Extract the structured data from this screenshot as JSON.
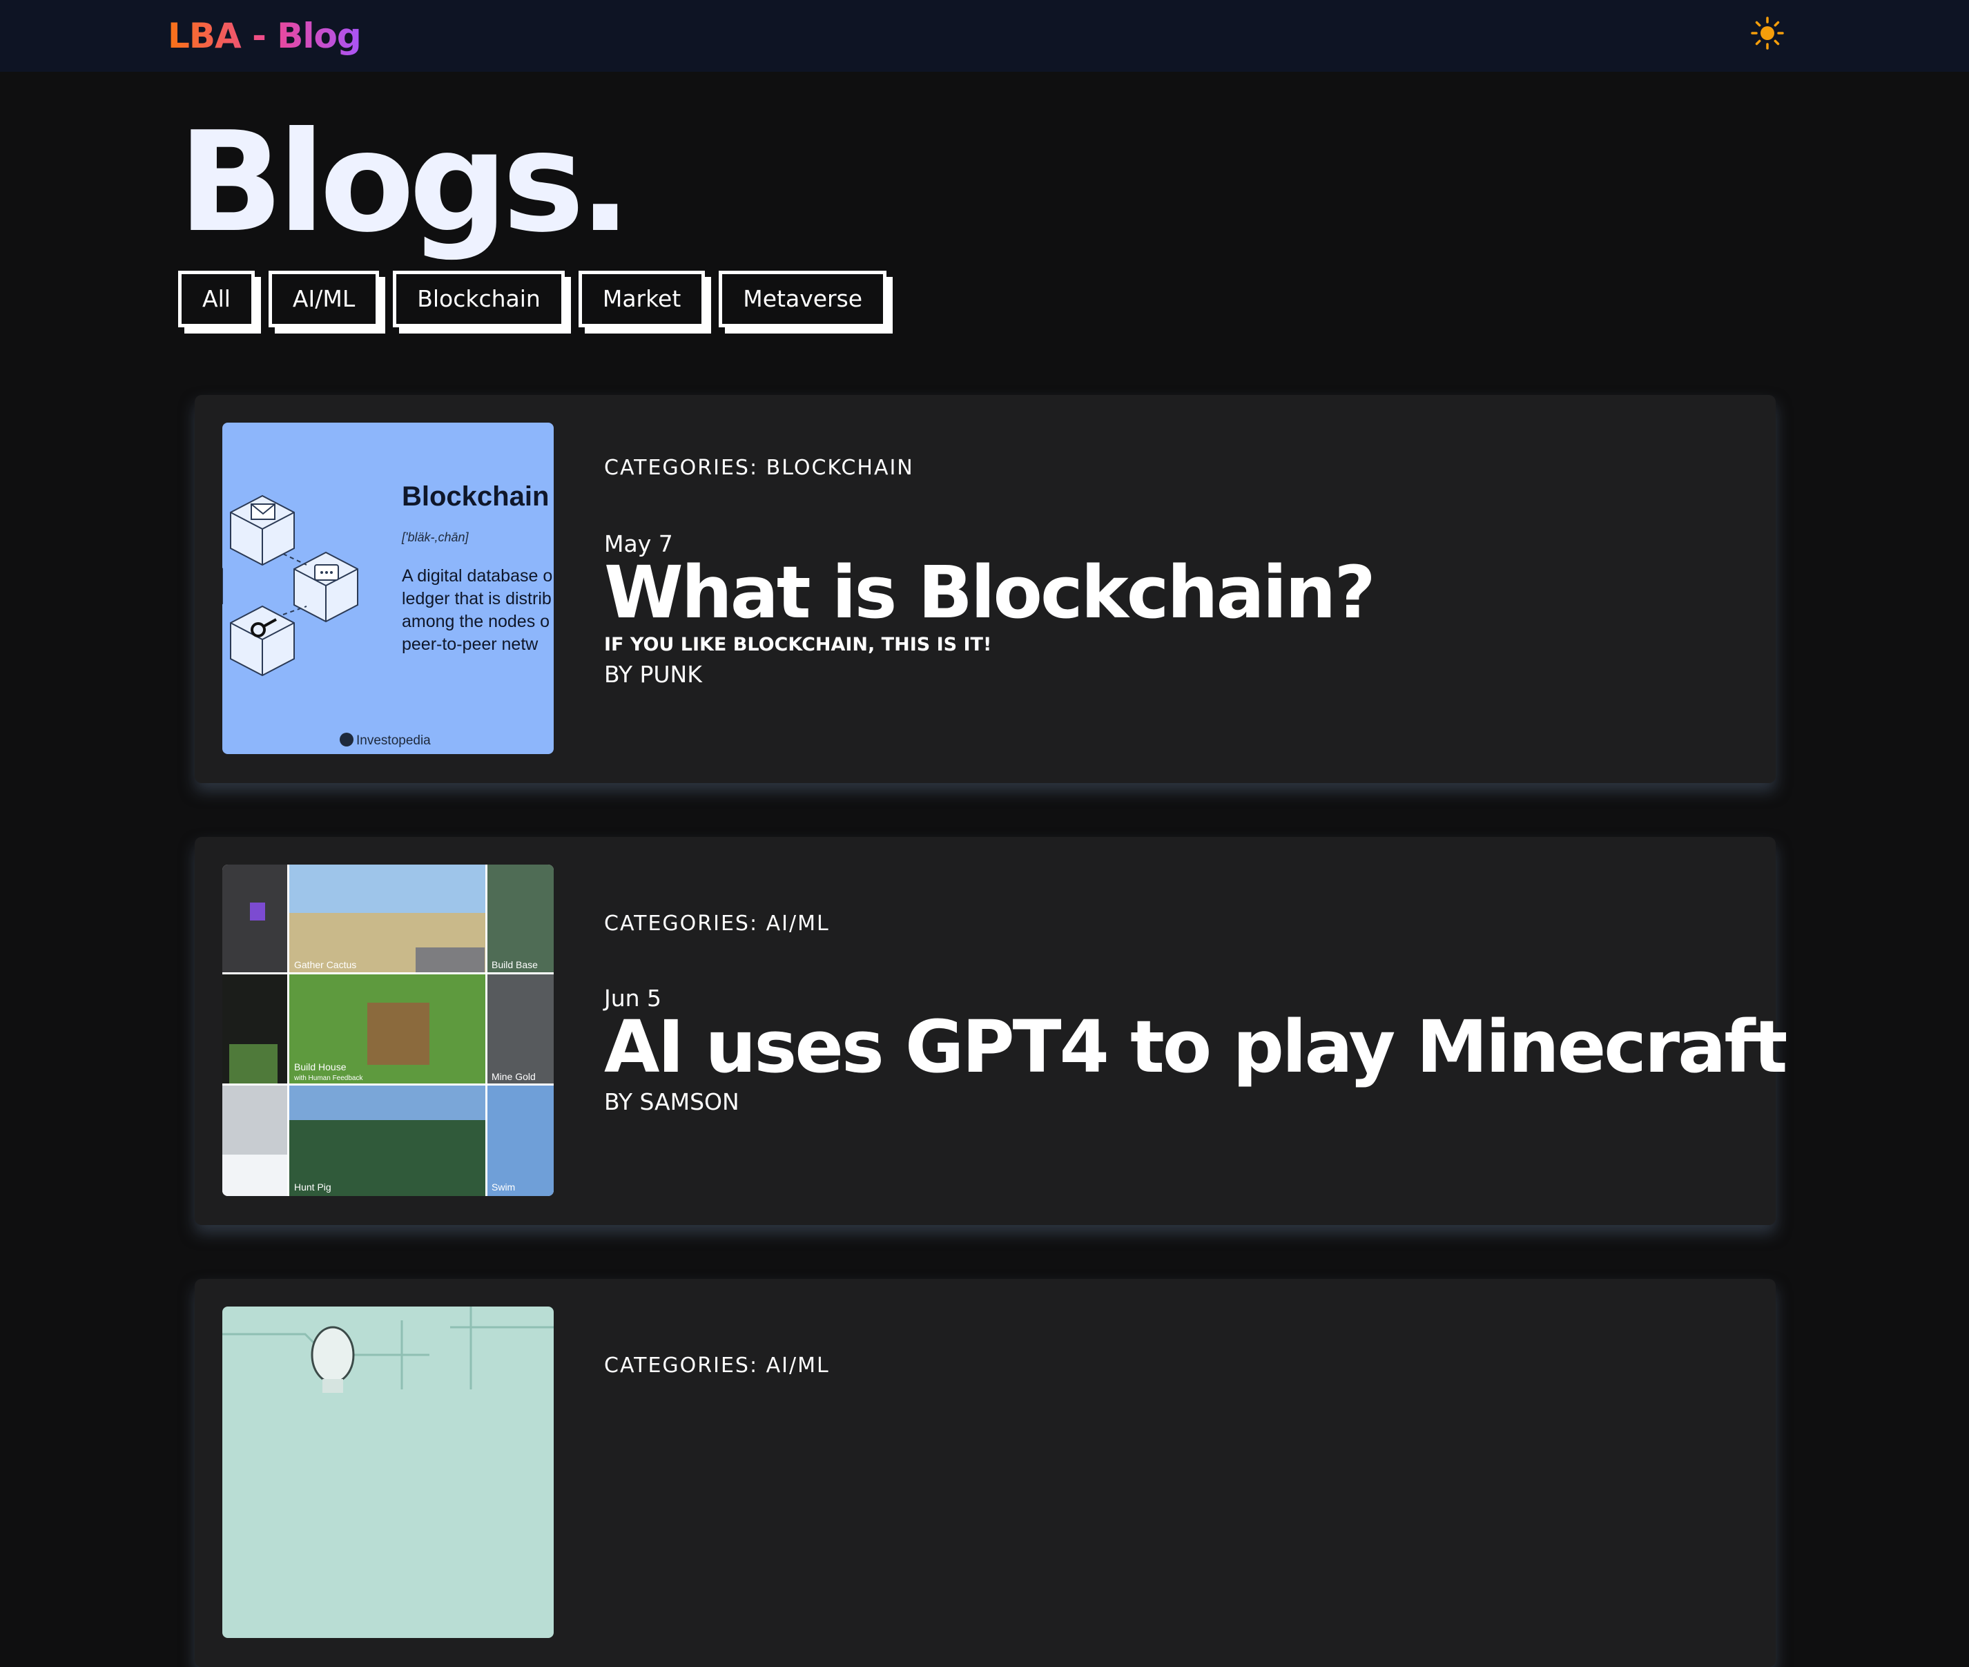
{
  "header": {
    "brand": "LBA - Blog",
    "theme_icon": "sun-icon"
  },
  "page": {
    "title": "Blogs."
  },
  "filters": [
    "All",
    "AI/ML",
    "Blockchain",
    "Market",
    "Metaverse"
  ],
  "posts": [
    {
      "categories": "CATEGORIES: BLOCKCHAIN",
      "date": "May 7",
      "title": "What is Blockchain?",
      "subtitle": "IF YOU LIKE BLOCKCHAIN, THIS IS IT!",
      "author": "BY PUNK",
      "image": {
        "heading": "Blockchain",
        "phonetic": "['bläk-,chān]",
        "definition": [
          "A digital database o",
          "ledger that is distrib",
          "among the nodes o",
          "peer-to-peer netw"
        ],
        "source": "Investopedia"
      }
    },
    {
      "categories": "CATEGORIES: AI/ML",
      "date": "Jun 5",
      "title": "AI uses GPT4 to play Minecraft",
      "author": "BY SAMSON",
      "image": {
        "tiles": [
          "Gather Cactus",
          "Build Base",
          "Build House",
          "with Human Feedback",
          "Mine Gold",
          "Hunt Pig",
          "Swim"
        ]
      }
    },
    {
      "categories": "CATEGORIES: AI/ML"
    }
  ]
}
